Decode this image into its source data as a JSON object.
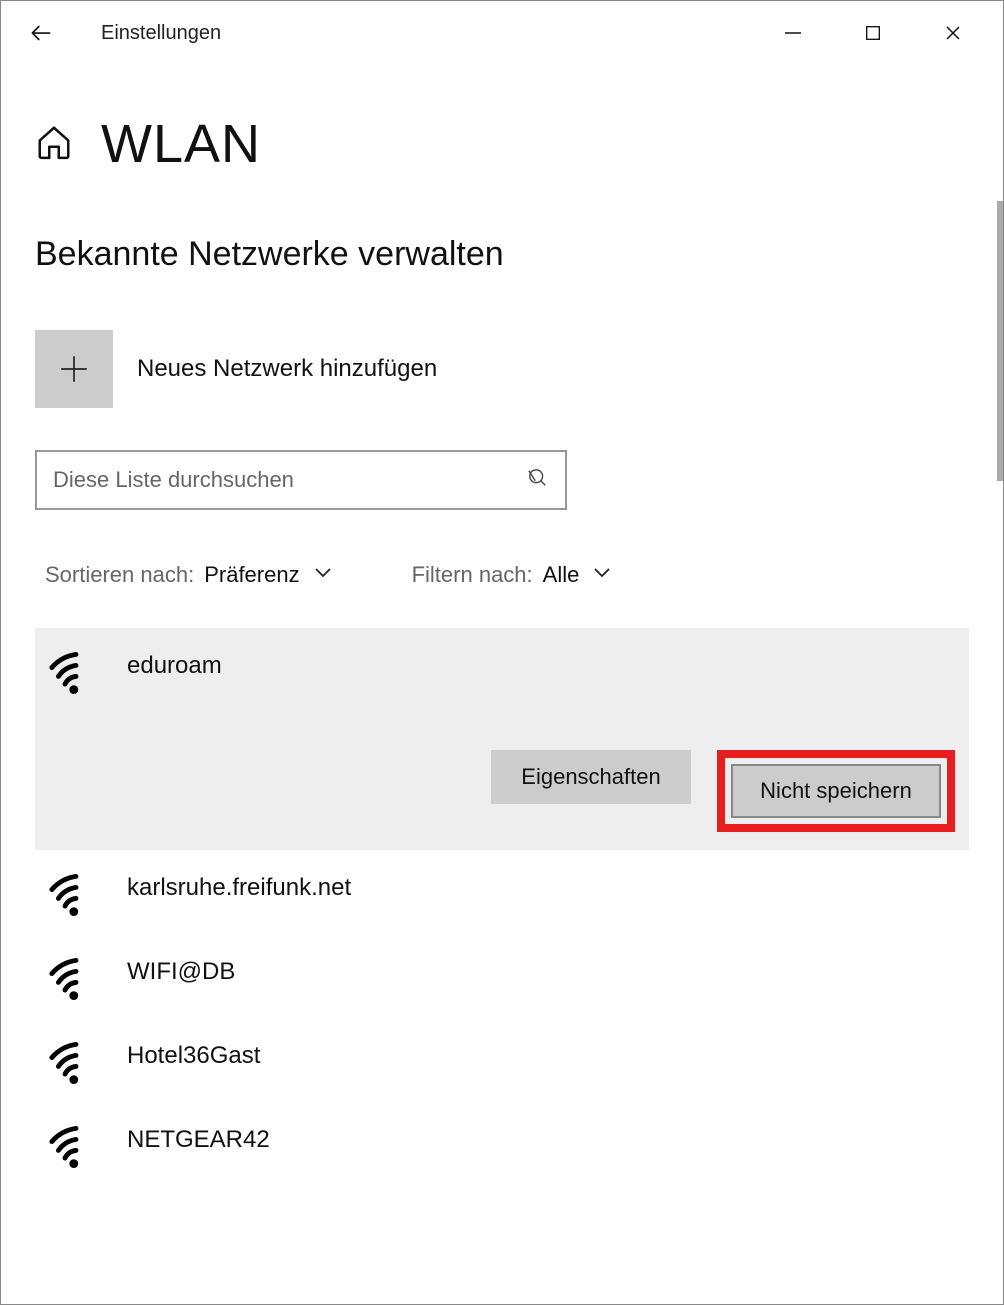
{
  "titlebar": {
    "app_title": "Einstellungen"
  },
  "page": {
    "title": "WLAN",
    "section_title": "Bekannte Netzwerke verwalten",
    "add_label": "Neues Netzwerk hinzufügen",
    "search_placeholder": "Diese Liste durchsuchen",
    "sort_label": "Sortieren nach:",
    "sort_value": "Präferenz",
    "filter_label": "Filtern nach:",
    "filter_value": "Alle"
  },
  "actions": {
    "properties": "Eigenschaften",
    "forget": "Nicht speichern"
  },
  "networks": [
    {
      "name": "eduroam",
      "selected": true
    },
    {
      "name": "karlsruhe.freifunk.net",
      "selected": false
    },
    {
      "name": "WIFI@DB",
      "selected": false
    },
    {
      "name": "Hotel36Gast",
      "selected": false
    },
    {
      "name": "NETGEAR42",
      "selected": false
    }
  ]
}
